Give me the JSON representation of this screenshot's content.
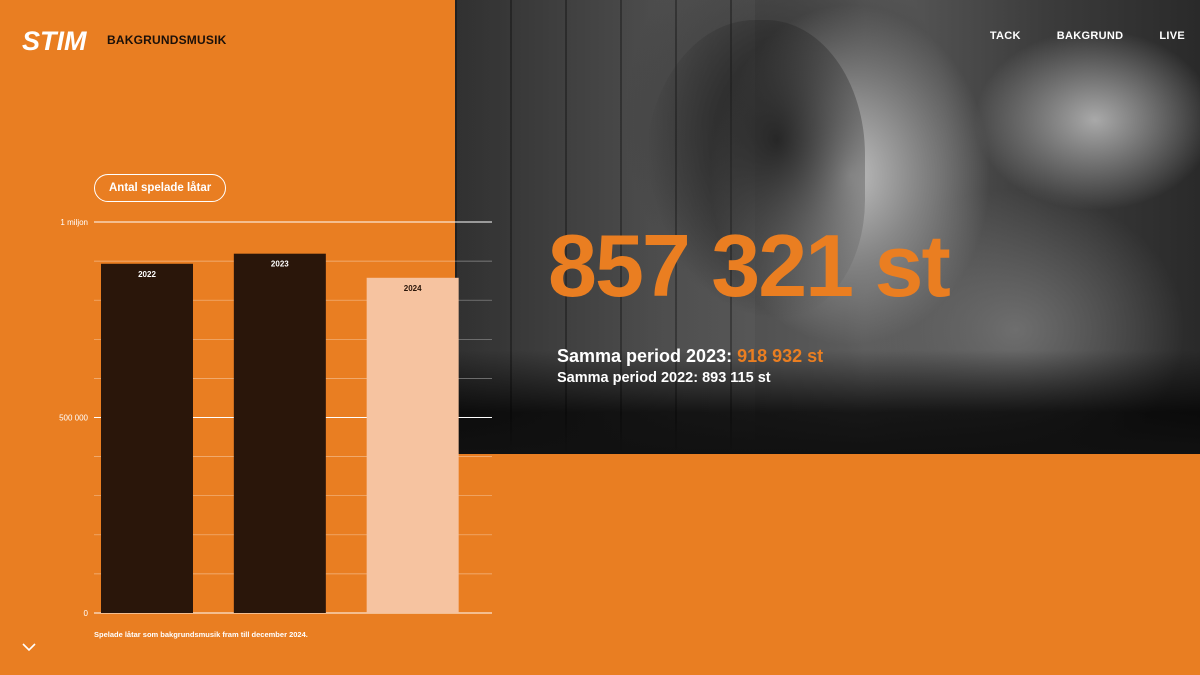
{
  "header": {
    "logo": "STIM",
    "section": "BAKGRUNDSMUSIK",
    "nav": [
      "TACK",
      "BAKGRUND",
      "LIVE"
    ]
  },
  "chart_toggle_label": "Antal spelade låtar",
  "chart_note": "Spelade låtar som bakgrundsmusik fram till december 2024.",
  "chart_data": {
    "type": "bar",
    "categories": [
      "2022",
      "2023",
      "2024"
    ],
    "values": [
      893115,
      918932,
      857321
    ],
    "y_tick_labels": [
      "0",
      "500 000",
      "1 miljon"
    ],
    "y_ticks": [
      0,
      500000,
      1000000
    ],
    "ylim": [
      0,
      1000000
    ],
    "grid": true,
    "colors": [
      "#2a160a",
      "#2a160a",
      "#f6c3a0"
    ]
  },
  "headline": {
    "value": "857 321 st",
    "compare_2023_label": "Samma period 2023:",
    "compare_2023_value": "918 932 st",
    "compare_2022": "Samma period 2022: 893 115 st"
  },
  "colors": {
    "background": "#e97e22",
    "accent": "#ea7e21",
    "bar_dark": "#2a160a",
    "bar_light": "#f6c3a0",
    "text_white": "#ffffff"
  },
  "icons": [
    "chevron-down-icon"
  ]
}
